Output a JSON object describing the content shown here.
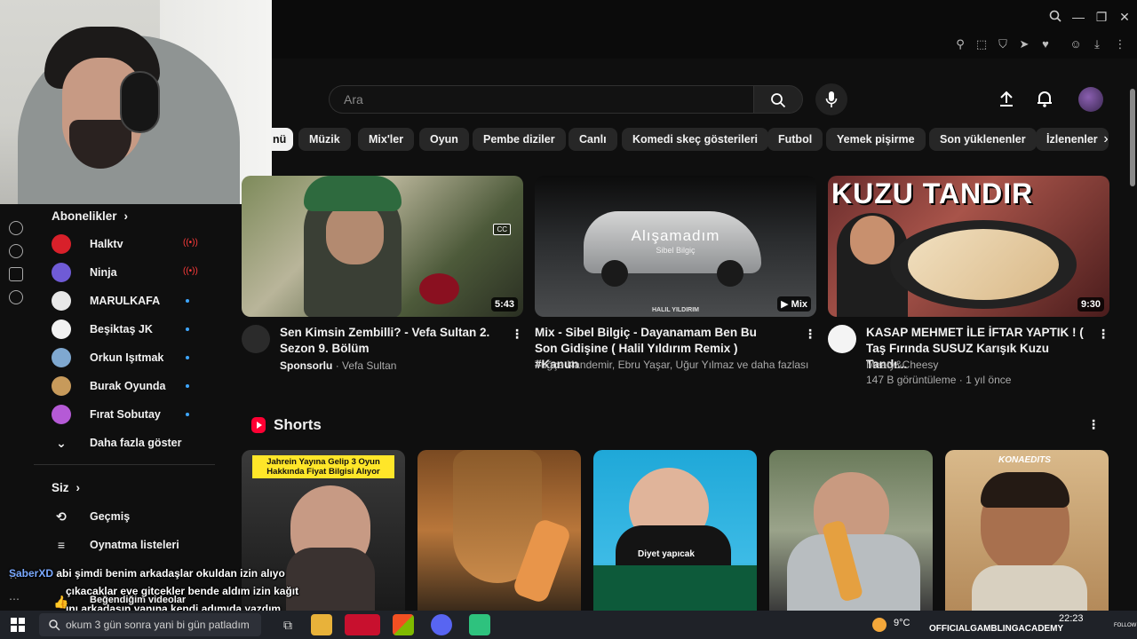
{
  "search": {
    "placeholder": "Ara"
  },
  "chips": [
    "nü",
    "Müzik",
    "Mix'ler",
    "Oyun",
    "Pembe diziler",
    "Canlı",
    "Komedi skeç gösterileri",
    "Futbol",
    "Yemek pişirme",
    "Son yüklenenler",
    "İzlenenler"
  ],
  "sidebar": {
    "subscriptions_heading": "Abonelikler",
    "subscriptions": [
      {
        "name": "Halktv",
        "indicator": "live",
        "color": "#d8202a"
      },
      {
        "name": "Ninja",
        "indicator": "live",
        "color": "#6f5bd6"
      },
      {
        "name": "MARULKAFA",
        "indicator": "dot",
        "color": "#e8e8e8"
      },
      {
        "name": "Beşiktaş JK",
        "indicator": "dot",
        "color": "#f2f2f2"
      },
      {
        "name": "Orkun Işıtmak",
        "indicator": "dot",
        "color": "#7fa8d0"
      },
      {
        "name": "Burak Oyunda",
        "indicator": "dot",
        "color": "#c79a5b"
      },
      {
        "name": "Fırat Sobutay",
        "indicator": "dot",
        "color": "#b55ad6"
      }
    ],
    "show_more": "Daha fazla göster",
    "you_heading": "Siz",
    "you_items": [
      {
        "label": "Geçmiş",
        "icon": "history-icon"
      },
      {
        "label": "Oynatma listeleri",
        "icon": "playlist-icon"
      },
      {
        "label": "Beğendiğim videolar",
        "icon": "thumb-up-icon"
      }
    ]
  },
  "videos": [
    {
      "title": "Sen Kimsin Zembilli? - Vefa Sultan 2. Sezon 9. Bölüm",
      "meta_prefix": "Sponsorlu",
      "channel": "Vefa Sultan",
      "duration": "5:43",
      "badge": "CC"
    },
    {
      "title": "Mix - Sibel Bilgiç - Dayanamam Ben Bu Son Gidişine ( Halil Yıldırım Remix ) #Kanun",
      "channel": "Tuğçe Kandemir, Ebru Yaşar, Uğur Yılmaz ve daha fazlası",
      "duration": "Mix",
      "overlay_title": "Alışamadım",
      "overlay_sub": "Sibel Bilgiç",
      "overlay_credit": "HALIL YILDIRIM"
    },
    {
      "title": "KASAP MEHMET İLE  İFTAR YAPTIK ! ( Taş Fırında SUSUZ Karışık Kuzu Tandı...",
      "channel": "Meaty&Cheesy",
      "stats": "147 B görüntüleme · 1 yıl önce",
      "duration": "9:30",
      "overlay_title": "KUZU TANDIR"
    }
  ],
  "shorts": {
    "heading": "Shorts",
    "items": [
      {
        "caption": "Jahrein Yayına Gelip 3 Oyun Hakkında Fiyat Bilgisi Alıyor"
      },
      {
        "caption": ""
      },
      {
        "caption": "Diyet yapıcak"
      },
      {
        "caption": ""
      },
      {
        "caption": "KONAEDITS"
      }
    ]
  },
  "chat": {
    "user": "SaberXD",
    "lines": [
      "abi şimdi benim arkadaşlar okuldan izin alıyo",
      "çıkacaklar eve gitcekler bende aldım izin kağıt",
      "ını arkadaşın yanına kendi adımıda yazdım",
      "okum 3 gün sonra yani bi gün patladım"
    ]
  },
  "taskbar": {
    "search_label": "Ara",
    "weather": "9°C",
    "time": "22:23",
    "overlay_brand": "OFFICIALGAMBLINGACADEMY",
    "follow": "FOLLOW"
  },
  "colors": {
    "accent": "#ff0033",
    "live": "#ff3b3b",
    "link": "#3ea6ff"
  }
}
